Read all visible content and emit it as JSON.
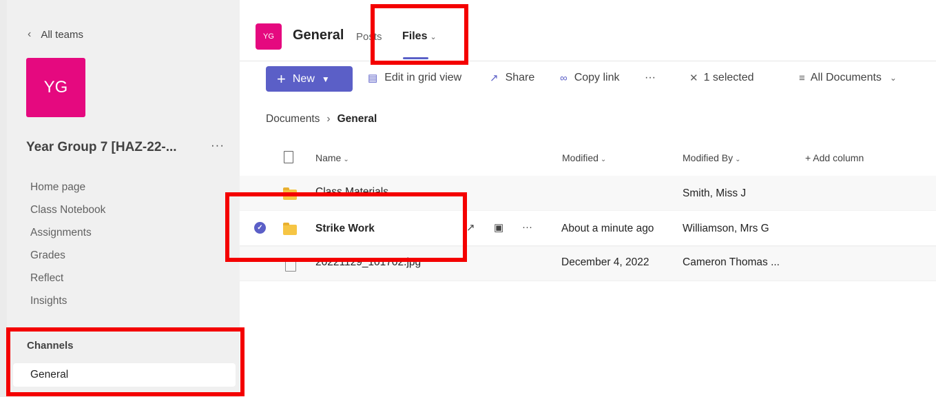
{
  "sidebar": {
    "back_label": "All teams",
    "team_avatar": "YG",
    "team_name": "Year Group 7 [HAZ-22-...",
    "team_more": "···",
    "nav_items": [
      "Home page",
      "Class Notebook",
      "Assignments",
      "Grades",
      "Reflect",
      "Insights"
    ],
    "channels_title": "Channels",
    "channels": [
      "General"
    ]
  },
  "header": {
    "avatar": "YG",
    "title": "General",
    "tabs": [
      "Posts",
      "Files"
    ]
  },
  "toolbar": {
    "new_label": "New",
    "grid_label": "Edit in grid view",
    "share_label": "Share",
    "copy_link_label": "Copy link",
    "more": "···",
    "selected_label": "1 selected",
    "view_label": "All Documents"
  },
  "breadcrumb": {
    "root": "Documents",
    "current": "General"
  },
  "table": {
    "columns": [
      "Name",
      "Modified",
      "Modified By",
      "Add column"
    ],
    "rows": [
      {
        "name": "Class Materials",
        "modified": "",
        "modified_by": "Smith, Miss J"
      },
      {
        "name": "Strike Work",
        "modified": "About a minute ago",
        "modified_by": "Williamson, Mrs G"
      },
      {
        "name": "20221129_101702.jpg",
        "modified": "December 4, 2022",
        "modified_by": "Cameron Thomas ..."
      }
    ],
    "row_more": "···"
  },
  "colors": {
    "accent": "#5b5fc7",
    "team": "#e5097f",
    "annotation": "#f40000"
  }
}
